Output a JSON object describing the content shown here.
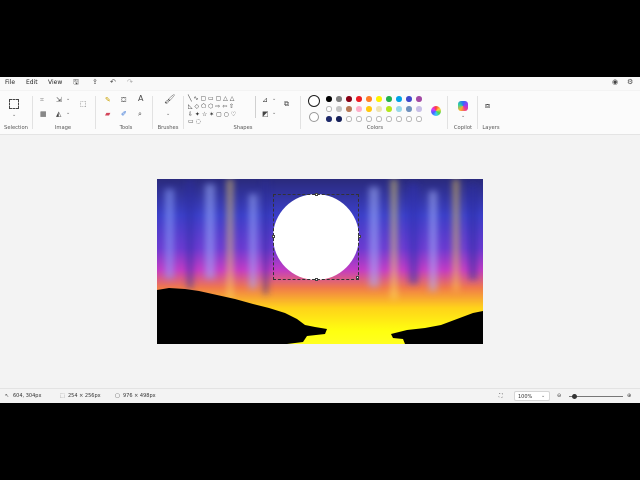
{
  "menu": {
    "file": "File",
    "edit": "Edit",
    "view": "View"
  },
  "groups": {
    "selection": "Selection",
    "image": "Image",
    "tools": "Tools",
    "brushes": "Brushes",
    "shapes": "Shapes",
    "colors": "Colors",
    "copilot": "Copilot",
    "layers": "Layers"
  },
  "tools_text_glyph": "A",
  "palette": {
    "row1": [
      "#000000",
      "#7f7f7f",
      "#880015",
      "#ed1c24",
      "#ff7f27",
      "#fff200",
      "#22b14c",
      "#00a2e8",
      "#3f48cc",
      "#a349a4"
    ],
    "row2": [
      "#ffffff",
      "#c3c3c3",
      "#b97a57",
      "#ffaec9",
      "#ffc90e",
      "#efe4b0",
      "#b5e61d",
      "#99d9ea",
      "#7092be",
      "#c8bfe7"
    ],
    "row3": [
      "#1f2a6b",
      "#16205a",
      "",
      "",
      "",
      "",
      "",
      "",
      "",
      ""
    ]
  },
  "status": {
    "cursor": "604, 304px",
    "selection_size": "254 × 256px",
    "canvas_size": "976 × 498px",
    "zoom": "100%"
  },
  "zoom_slider_level": 0.1
}
